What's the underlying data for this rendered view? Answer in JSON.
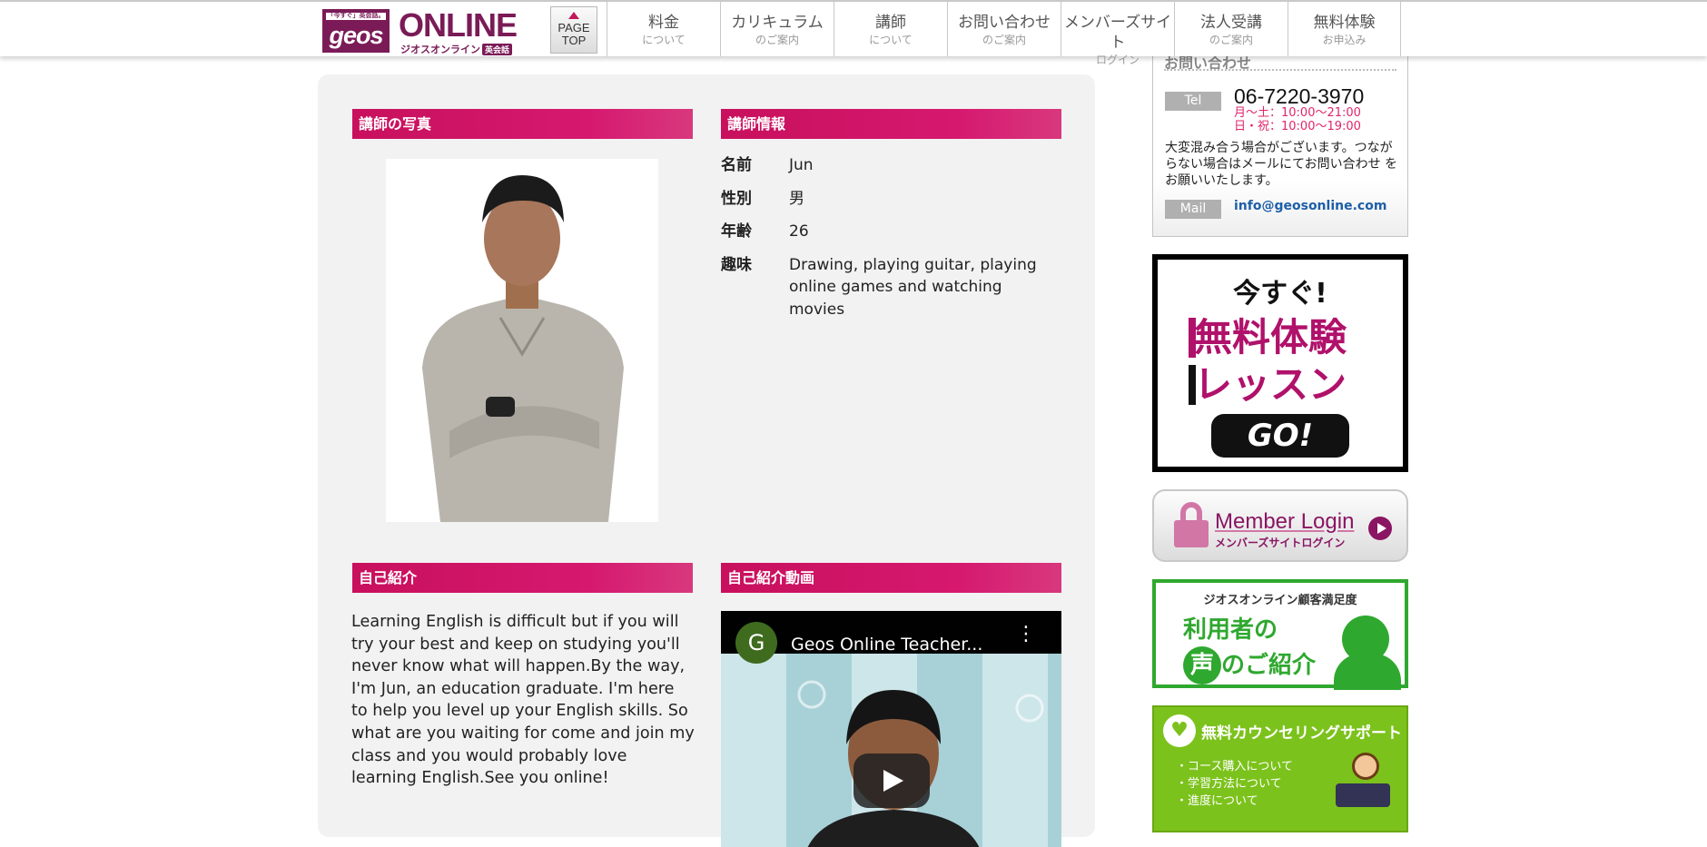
{
  "header": {
    "logo": {
      "tagline": "「今すぐ」英会話。",
      "brand": "geos",
      "wordmark": "ONLINE",
      "subtitle": "ジオスオンライン",
      "badge": "英会話"
    },
    "page_top": {
      "line1": "PAGE",
      "line2": "TOP"
    },
    "nav": [
      {
        "label": "料金",
        "sub": "について"
      },
      {
        "label": "カリキュラム",
        "sub": "のご案内"
      },
      {
        "label": "講師",
        "sub": "について"
      },
      {
        "label": "お問い合わせ",
        "sub": "のご案内"
      },
      {
        "label": "メンバーズサイト",
        "sub": "ログイン"
      },
      {
        "label": "法人受講",
        "sub": "のご案内"
      },
      {
        "label": "無料体験",
        "sub": "お申込み"
      }
    ]
  },
  "teacher": {
    "photo_heading": "講師の写真",
    "info_heading": "講師情報",
    "info": [
      {
        "label": "名前",
        "value": "Jun"
      },
      {
        "label": "性別",
        "value": "男"
      },
      {
        "label": "年齢",
        "value": "26"
      },
      {
        "label": "趣味",
        "value": "Drawing, playing guitar, playing online games and watching movies"
      }
    ],
    "intro_heading": "自己紹介",
    "intro_text": "Learning English is difficult but if you will try your best and keep on studying you'll never know what will happen.By the way, I'm Jun, an education graduate. I'm here to help you level up your English skills. So what are you waiting for come and join my class and you would probably love learning English.See you online!",
    "video_heading": "自己紹介動画",
    "video": {
      "channel_initial": "G",
      "title": "Geos Online Teacher...",
      "menu": "⋮"
    }
  },
  "sidebar": {
    "contact": {
      "heading": "お問い合わせ",
      "tel_label": "Tel",
      "tel_number": "06-7220-3970",
      "hours_weekday": "月〜土：10:00〜21:00",
      "hours_holiday": "日・祝：10:00〜19:00",
      "note": "大変混み合う場合がございます。つながらない場合はメールにてお問い合わせ をお願いいたします。",
      "mail_label": "Mail",
      "mail_address": "info@geosonline.com"
    },
    "trial_banner": {
      "top": "今すぐ!",
      "line1": "無料体験",
      "line2": "レッスン",
      "go": "GO!"
    },
    "login_banner": {
      "title": "Member Login",
      "sub": "メンバーズサイトログイン"
    },
    "voice_banner": {
      "top": "ジオスオンライン顧客満足度",
      "line1": "利用者の",
      "koe": "声",
      "line2": "のご紹介"
    },
    "counsel_banner": {
      "icon": "♥",
      "title": "無料カウンセリングサポート",
      "items": [
        "・コース購入について",
        "・学習方法について",
        "・進度について"
      ]
    }
  },
  "colors": {
    "accent": "#d6196f",
    "brand": "#7a1b57",
    "green": "#2fa82f",
    "lime": "#7cc21c"
  }
}
